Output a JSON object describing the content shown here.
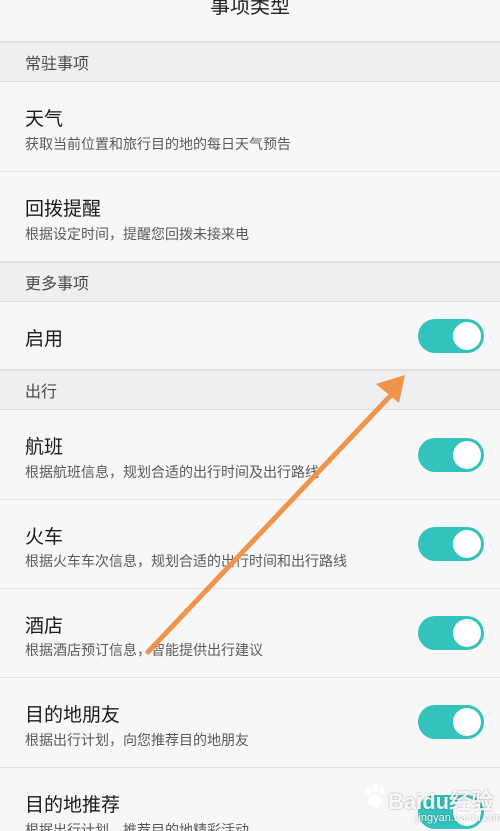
{
  "header": {
    "title": "事项类型"
  },
  "sections": {
    "resident": {
      "label": "常驻事项",
      "items": [
        {
          "title": "天气",
          "subtitle": "获取当前位置和旅行目的地的每日天气预告"
        },
        {
          "title": "回拨提醒",
          "subtitle": "根据设定时间，提醒您回拨未接来电"
        }
      ]
    },
    "more": {
      "label": "更多事项",
      "enable": {
        "title": "启用",
        "enabled": true
      }
    },
    "travel": {
      "label": "出行",
      "items": [
        {
          "title": "航班",
          "subtitle": "根据航班信息，规划合适的出行时间及出行路线",
          "enabled": true
        },
        {
          "title": "火车",
          "subtitle": "根据火车车次信息，规划合适的出行时间和出行路线",
          "enabled": true
        },
        {
          "title": "酒店",
          "subtitle": "根据酒店预订信息，智能提供出行建议",
          "enabled": true
        },
        {
          "title": "目的地朋友",
          "subtitle": "根据出行计划，向您推荐目的地朋友",
          "enabled": true
        },
        {
          "title": "目的地推荐",
          "subtitle": "根据出行计划，推荐目的地精彩活动",
          "enabled": true
        }
      ]
    }
  },
  "watermark": {
    "text": "Baidu经验",
    "sub": "jingyan.baidu.com"
  },
  "colors": {
    "toggle_on": "#33c2bc",
    "arrow": "#f0944a",
    "section_bg": "#efeef0",
    "row_bg": "#f8f7f8"
  }
}
